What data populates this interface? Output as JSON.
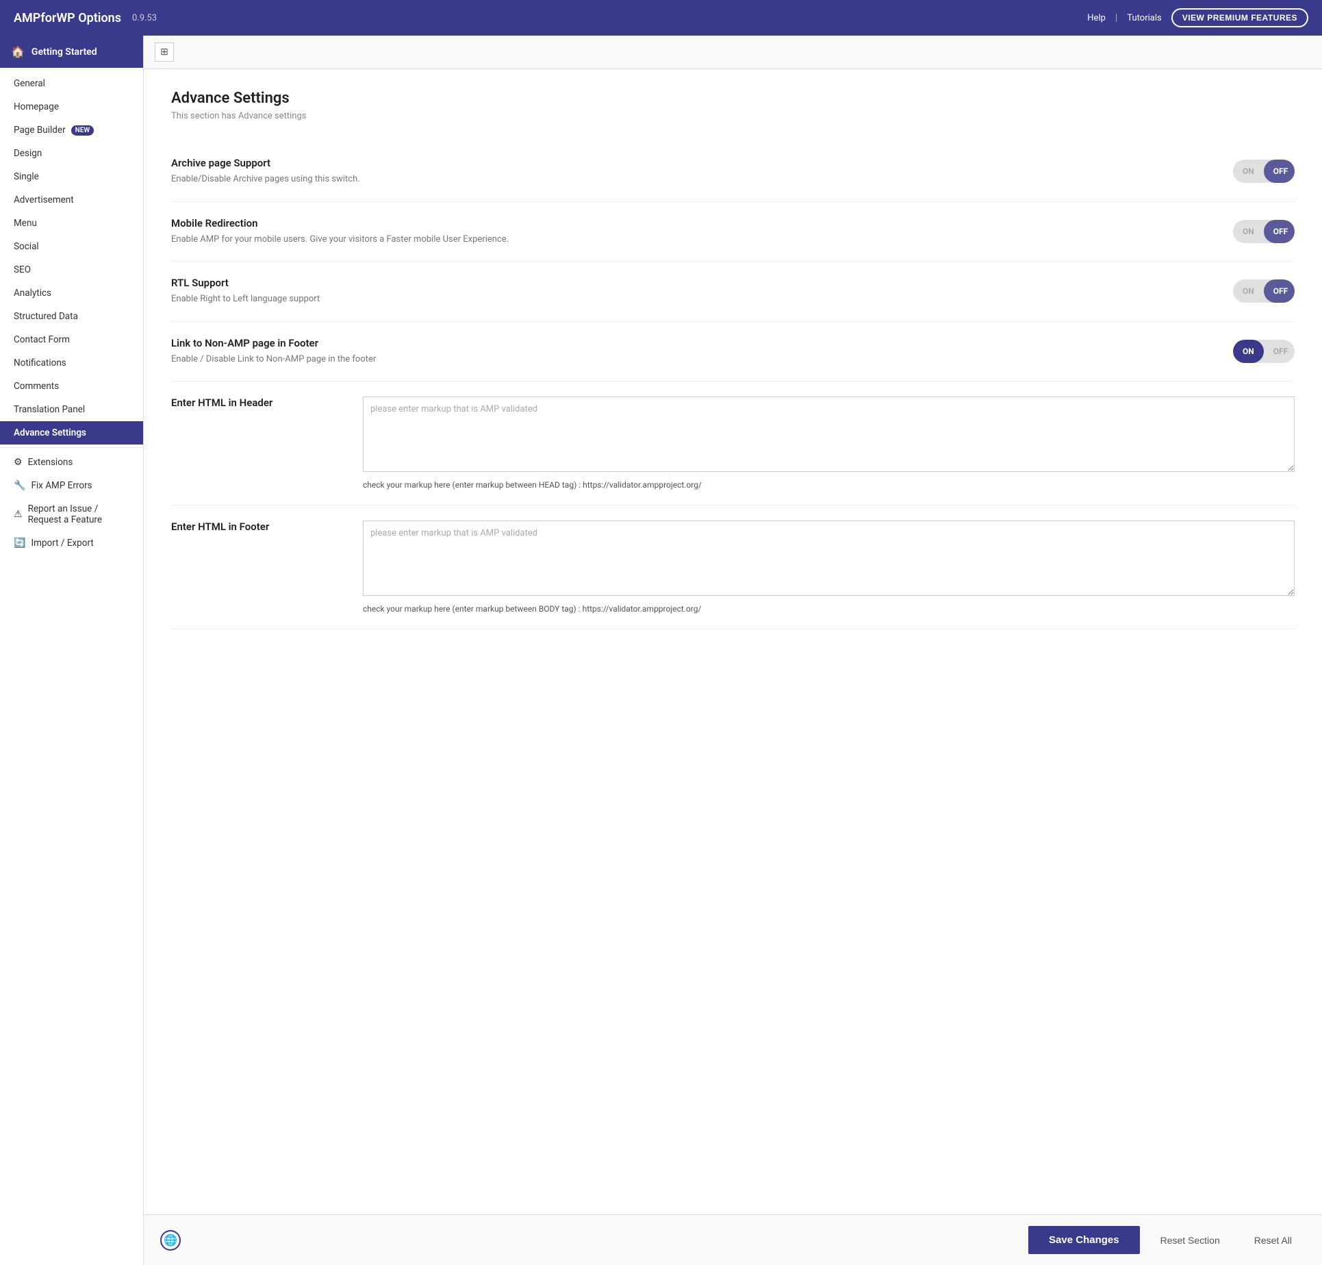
{
  "header": {
    "title": "AMPforWP Options",
    "version": "0.9.53",
    "help_label": "Help",
    "tutorials_label": "Tutorials",
    "premium_btn": "VIEW PREMIUM FEATURES"
  },
  "sidebar": {
    "getting_started": "Getting Started",
    "items": [
      {
        "label": "General",
        "active": false,
        "badge": ""
      },
      {
        "label": "Homepage",
        "active": false,
        "badge": ""
      },
      {
        "label": "Page Builder",
        "active": false,
        "badge": "NEW"
      },
      {
        "label": "Design",
        "active": false,
        "badge": ""
      },
      {
        "label": "Single",
        "active": false,
        "badge": ""
      },
      {
        "label": "Advertisement",
        "active": false,
        "badge": ""
      },
      {
        "label": "Menu",
        "active": false,
        "badge": ""
      },
      {
        "label": "Social",
        "active": false,
        "badge": ""
      },
      {
        "label": "SEO",
        "active": false,
        "badge": ""
      },
      {
        "label": "Analytics",
        "active": false,
        "badge": ""
      },
      {
        "label": "Structured Data",
        "active": false,
        "badge": ""
      },
      {
        "label": "Contact Form",
        "active": false,
        "badge": ""
      },
      {
        "label": "Notifications",
        "active": false,
        "badge": ""
      },
      {
        "label": "Comments",
        "active": false,
        "badge": ""
      },
      {
        "label": "Translation Panel",
        "active": false,
        "badge": ""
      },
      {
        "label": "Advance Settings",
        "active": true,
        "badge": ""
      }
    ],
    "extensions": "Extensions",
    "fix_amp_errors": "Fix AMP Errors",
    "report_issue": "Report an Issue /",
    "request_feature": "Request a Feature",
    "import_export": "Import / Export"
  },
  "content": {
    "title": "Advance Settings",
    "description": "This section has Advance settings",
    "settings": [
      {
        "name": "Archive page Support",
        "desc": "Enable/Disable Archive pages using this switch.",
        "state": "off"
      },
      {
        "name": "Mobile Redirection",
        "desc": "Enable AMP for your mobile users. Give your visitors a Faster mobile User Experience.",
        "state": "off"
      },
      {
        "name": "RTL Support",
        "desc": "Enable Right to Left language support",
        "state": "off"
      },
      {
        "name": "Link to Non-AMP page in Footer",
        "desc": "Enable / Disable Link to Non-AMP page in the footer",
        "state": "on"
      }
    ],
    "html_header": {
      "title": "Enter HTML in Header",
      "placeholder": "please enter markup that is AMP validated",
      "hint": "check your markup here (enter markup between HEAD tag) : https://validator.ampproject.org/"
    },
    "html_footer": {
      "title": "Enter HTML in Footer",
      "placeholder": "please enter markup that is AMP validated",
      "hint": "check your markup here (enter markup between BODY tag) : https://validator.ampproject.org/"
    }
  },
  "footer": {
    "save_label": "Save Changes",
    "reset_section_label": "Reset Section",
    "reset_all_label": "Reset All"
  }
}
